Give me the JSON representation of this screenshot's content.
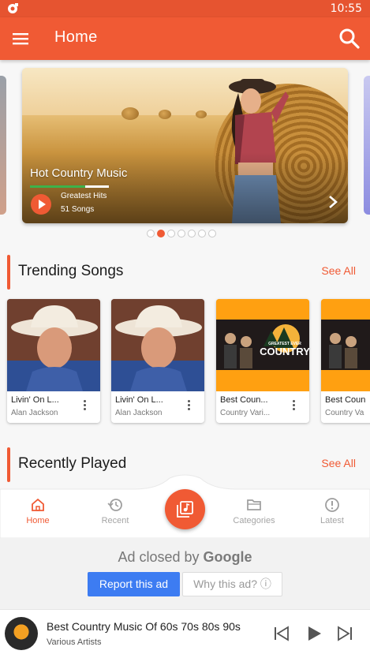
{
  "status_bar": {
    "time": "10:55"
  },
  "app_bar": {
    "title": "Home",
    "menu_icon": "hamburger-menu-icon",
    "search_icon": "search-icon"
  },
  "carousel": {
    "title": "Hot Country Music",
    "subtitle": "Greatest Hits",
    "song_count": "51 Songs",
    "progress": 0.7,
    "pages": 7,
    "active_page": 1
  },
  "trending": {
    "heading": "Trending Songs",
    "see_all": "See All",
    "items": [
      {
        "song": "Livin' On L...",
        "artist": "Alan Jackson"
      },
      {
        "song": "Livin' On L...",
        "artist": "Alan Jackson"
      },
      {
        "song": "Best Coun...",
        "artist": "Country Vari..."
      },
      {
        "song": "Best Coun",
        "artist": "Country Va"
      }
    ]
  },
  "recent": {
    "heading": "Recently Played",
    "see_all": "See All"
  },
  "art_text": {
    "top": "GREATEST EVER",
    "main": "COUNTRY"
  },
  "nav": {
    "items": [
      {
        "label": "Home",
        "icon": "home-icon",
        "active": true
      },
      {
        "label": "Recent",
        "icon": "history-icon",
        "active": false
      },
      {
        "label": "Categories",
        "icon": "folder-icon",
        "active": false
      },
      {
        "label": "Latest",
        "icon": "info-icon",
        "active": false
      }
    ],
    "center_icon": "music-library-icon"
  },
  "ad": {
    "closed_prefix": "Ad closed by",
    "brand": "Google",
    "report": "Report this ad",
    "why": "Why this ad? ⓘ"
  },
  "player": {
    "title": "Best Country Music Of 60s 70s 80s 90s",
    "artist": "Various Artists"
  },
  "colors": {
    "accent": "#f05a34",
    "status_bar": "#e65430",
    "ad_button": "#3d7cf2",
    "progress": "#3db24a"
  }
}
